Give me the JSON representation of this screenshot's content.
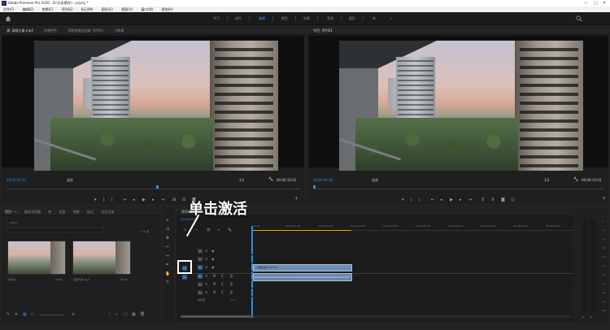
{
  "window": {
    "title": "Adobe Premiere Pro 2020 - D:\\头条素材\\一.prproj *",
    "controls": [
      "—",
      "□",
      "✕"
    ]
  },
  "menu": [
    "文件(F)",
    "编辑(E)",
    "剪辑(C)",
    "序列(S)",
    "标记(M)",
    "图形(G)",
    "视图(V)",
    "窗口(W)",
    "帮助(H)"
  ],
  "workspaces": {
    "tabs": [
      "学习",
      "组件",
      "编辑",
      "颜色",
      "效果",
      "音频",
      "图形",
      "库"
    ],
    "active_index": 2,
    "more": "»"
  },
  "source_monitor": {
    "tabs": [
      "源: 高楼大厦.mp4",
      "效果控件",
      "音频剪辑混合器: 序列01",
      "元数据"
    ],
    "timecode_left": "00;00;07;11",
    "fit": "适合",
    "fraction": "1/2",
    "timecode_right": "00;00;15;01"
  },
  "program_monitor": {
    "tabs": [
      "节目: 序列01"
    ],
    "timecode_left": "00;00;00;00",
    "fit": "适合",
    "fraction": "1/2",
    "timecode_right": "00;00;15;01"
  },
  "project_panel": {
    "tabs": [
      "项目: 一",
      "媒体浏览器",
      "库",
      "信息",
      "效果",
      "标记",
      "历史记录"
    ],
    "path": "一.prproj",
    "count": "1 / 2 项",
    "items": [
      {
        "name": "序列01",
        "duration": "15;01"
      },
      {
        "name": "高楼大厦.mp4",
        "duration": "15;01"
      }
    ]
  },
  "timeline": {
    "tab": "序列01",
    "timecode": "00;00;00;00",
    "ruler": [
      "00;00",
      "00;00;04;29",
      "00;00;09;29",
      "00;00;14;29",
      "00;00;19;29",
      "00;00;24;29",
      "00;00;29;29",
      "00;00;34;28",
      "00;00;39;29",
      "00;00;44;28"
    ],
    "video_tracks": [
      "V3",
      "V2",
      "V1"
    ],
    "audio_tracks": [
      "A1",
      "A2",
      "A3"
    ],
    "master": "主声道",
    "master_value": "0.0",
    "video_clip_label": "高楼大厦.mp4 [V]",
    "source_patch_v": "V1",
    "source_patch_a": "A1"
  },
  "meter": {
    "scale": [
      "0",
      "-6",
      "-12",
      "-18",
      "-24",
      "-30",
      "-36",
      "-42",
      "-48",
      "-54",
      "dB"
    ],
    "solo": "S",
    "solo2": "S"
  },
  "annotation": {
    "text": "单击激活"
  },
  "colors": {
    "accent": "#2d8ceb",
    "clip_video": "#6f8cb2",
    "clip_audio": "#6a86ad",
    "work_area": "#d8b000"
  }
}
